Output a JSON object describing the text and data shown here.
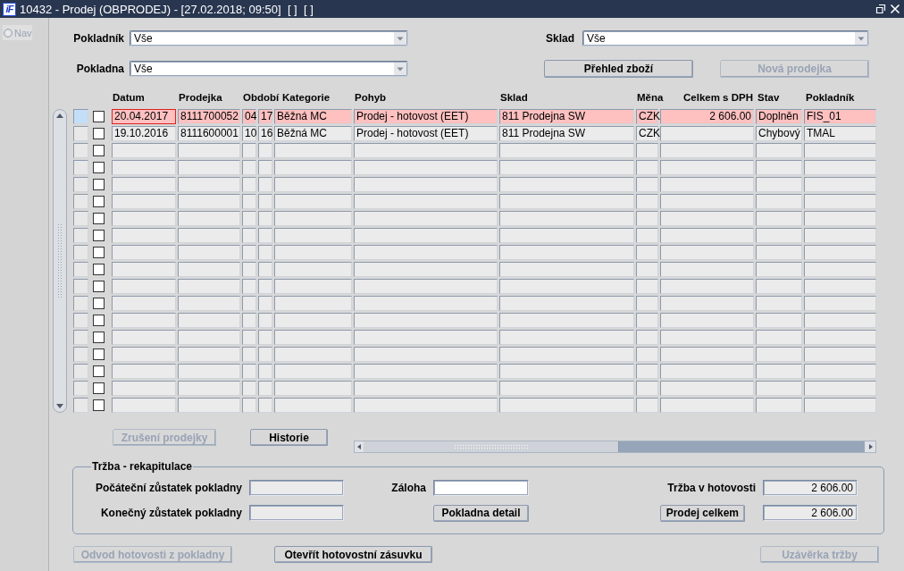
{
  "window": {
    "logo": "iF",
    "title": "10432 - Prodej (OBPRODEJ) - [27.02.2018; 09:50]  [ ]  [ ]"
  },
  "nav": {
    "label": "Nav",
    "disabled": true
  },
  "filters": [
    {
      "label": "Pokladník",
      "value": "Vše"
    },
    {
      "label": "Sklad",
      "value": "Vše"
    },
    {
      "label": "Pokladna",
      "value": "Vše"
    }
  ],
  "top_buttons": [
    {
      "label": "Přehled zboží",
      "disabled": false
    },
    {
      "label": "Nová prodejka",
      "disabled": true
    }
  ],
  "table": {
    "columns": [
      {
        "label": "Datum",
        "kind": "text"
      },
      {
        "label": "Prodejka",
        "kind": "text"
      },
      {
        "label": "Období",
        "kind": "text"
      },
      {
        "kind": "text"
      },
      {
        "label": "Kategorie",
        "kind": "text"
      },
      {
        "label": "Pohyb",
        "kind": "text"
      },
      {
        "label": "Sklad",
        "kind": "text"
      },
      {
        "label": "Měna",
        "kind": "text"
      },
      {
        "label": "Celkem s DPH",
        "kind": "number"
      },
      {
        "label": "Stav",
        "kind": "text"
      },
      {
        "label": "Pokladník",
        "kind": "text"
      }
    ],
    "rows": [
      {
        "selected": true,
        "focused": true,
        "checked": false,
        "cells": [
          "20.04.2017",
          "8111700052",
          "04",
          "17",
          "Běžná MC",
          "Prodej - hotovost (EET)",
          "811 Prodejna SW",
          "CZK",
          "2 606.00",
          "Doplněn",
          "FIS_01"
        ]
      },
      {
        "selected": false,
        "focused": false,
        "checked": false,
        "cells": [
          "19.10.2016",
          "8111600001",
          "10",
          "16",
          "Běžná MC",
          "Prodej - hotovost (EET)",
          "811 Prodejna SW",
          "CZK",
          null,
          "Chybový",
          "TMAL"
        ]
      },
      {
        "selected": false,
        "checked": false
      },
      {
        "selected": false,
        "checked": false
      },
      {
        "selected": false,
        "checked": false
      },
      {
        "selected": false,
        "checked": false
      },
      {
        "selected": false,
        "checked": false
      },
      {
        "selected": false,
        "checked": false
      },
      {
        "selected": false,
        "checked": false
      },
      {
        "selected": false,
        "checked": false
      },
      {
        "selected": false,
        "checked": false
      },
      {
        "selected": false,
        "checked": false
      },
      {
        "selected": false,
        "checked": false
      },
      {
        "selected": false,
        "checked": false
      },
      {
        "selected": false,
        "checked": false
      },
      {
        "selected": false,
        "checked": false
      },
      {
        "selected": false,
        "checked": false
      },
      {
        "selected": false,
        "checked": false
      }
    ]
  },
  "table_buttons": [
    {
      "label": "Zrušení prodejky",
      "disabled": true
    },
    {
      "label": "Historie",
      "disabled": false
    }
  ],
  "recap": {
    "title": "Tržba - rekapitulace",
    "items": [
      {
        "kind": "field",
        "label": "Počáteční zůstatek pokladny",
        "editable": false
      },
      {
        "kind": "field",
        "label": "Záloha",
        "editable": true
      },
      {
        "kind": "field",
        "label": "Tržba v hotovosti",
        "editable": false,
        "value": "2 606.00"
      },
      {
        "kind": "field",
        "label": "Konečný zůstatek pokladny",
        "editable": false
      },
      {
        "kind": "button",
        "label": "Pokladna detail"
      },
      {
        "kind": "button-field",
        "label": "Prodej celkem",
        "editable": false,
        "value": "2 606.00"
      }
    ]
  },
  "bottom_buttons": [
    {
      "label": "Odvod hotovosti z pokladny",
      "disabled": true
    },
    {
      "label": "Otevřít hotovostní zásuvku",
      "disabled": false
    },
    {
      "label": "Uzávěrka tržby",
      "disabled": true
    }
  ]
}
